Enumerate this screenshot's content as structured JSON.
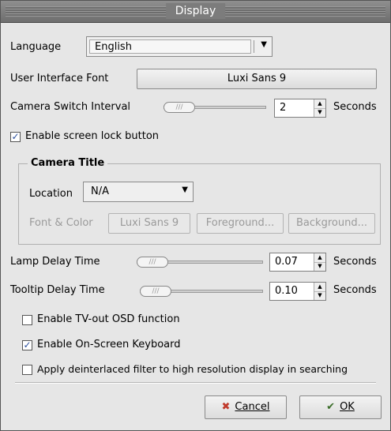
{
  "window": {
    "title": "Display"
  },
  "language": {
    "label": "Language",
    "value": "English"
  },
  "ui_font": {
    "label": "User Interface Font",
    "value": "Luxi Sans 9"
  },
  "camera_switch": {
    "label": "Camera Switch Interval",
    "value": "2",
    "unit": "Seconds",
    "slider_fraction": 0.05
  },
  "screen_lock": {
    "label": "Enable screen lock button",
    "checked": true
  },
  "camera_title": {
    "legend": "Camera Title",
    "location_label": "Location",
    "location_value": "N/A",
    "font_color_label": "Font & Color",
    "font_button": "Luxi Sans 9",
    "foreground_button": "Foreground...",
    "background_button": "Background..."
  },
  "lamp_delay": {
    "label": "Lamp Delay Time",
    "value": "0.07",
    "unit": "Seconds",
    "slider_fraction": 0.05
  },
  "tooltip_delay": {
    "label": "Tooltip Delay Time",
    "value": "0.10",
    "unit": "Seconds",
    "slider_fraction": 0.05
  },
  "tv_out": {
    "label": "Enable TV-out OSD function",
    "checked": false
  },
  "onscreen_keyboard": {
    "label": "Enable On-Screen Keyboard",
    "checked": true
  },
  "deinterlace": {
    "label": "Apply deinterlaced filter to high resolution display in searching",
    "checked": false
  },
  "buttons": {
    "cancel": "Cancel",
    "ok": "OK"
  },
  "icons": {
    "combo_arrow": "chevron-down-icon",
    "checkmark": "checkmark-icon",
    "cancel": "x-icon",
    "ok": "checkmark-hand-icon"
  }
}
